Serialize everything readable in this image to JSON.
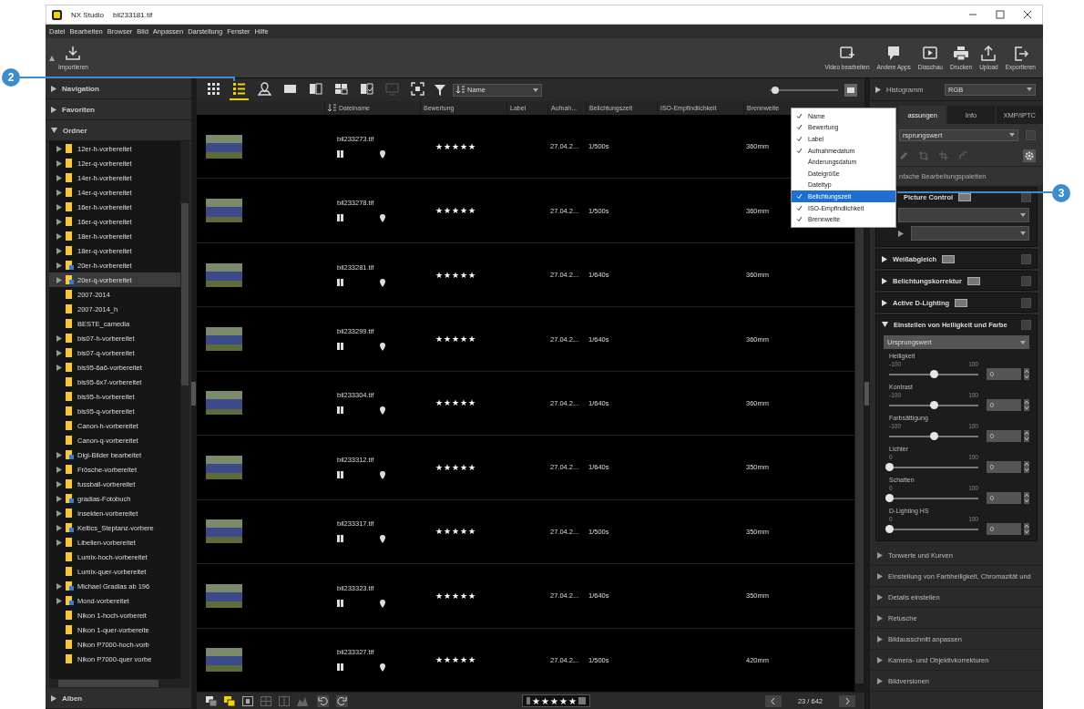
{
  "window": {
    "app_name": "NX Studio",
    "title": "bil233181.tif"
  },
  "menu": [
    "Datei",
    "Bearbeiten",
    "Browser",
    "Bild",
    "Anpassen",
    "Darstellung",
    "Fenster",
    "Hilfe"
  ],
  "toolbar": {
    "left": [
      {
        "kind": "import",
        "label": "Importieren"
      }
    ],
    "right": [
      {
        "kind": "video",
        "label": "Video bearbeiten"
      },
      {
        "kind": "apps",
        "label": "Andere Apps"
      },
      {
        "kind": "slideshow",
        "label": "Diaschau"
      },
      {
        "kind": "print",
        "label": "Drucken"
      },
      {
        "kind": "upload",
        "label": "Upload"
      },
      {
        "kind": "export",
        "label": "Exportieren"
      }
    ]
  },
  "sidebar": {
    "sections": [
      {
        "label": "Navigation",
        "expanded": false
      },
      {
        "label": "Favoriten",
        "expanded": false
      },
      {
        "label": "Ordner",
        "expanded": true
      }
    ],
    "folders": [
      {
        "label": "12er-h-vorbereitet",
        "expandable": true,
        "shared": false,
        "selected": false
      },
      {
        "label": "12er-q-vorbereitet",
        "expandable": true,
        "shared": false,
        "selected": false
      },
      {
        "label": "14er-h-vorbereitet",
        "expandable": true,
        "shared": false,
        "selected": false
      },
      {
        "label": "14er-q-vorbereitet",
        "expandable": true,
        "shared": false,
        "selected": false
      },
      {
        "label": "16er-h-vorbereitet",
        "expandable": true,
        "shared": false,
        "selected": false
      },
      {
        "label": "16er-q-vorbereitet",
        "expandable": true,
        "shared": false,
        "selected": false
      },
      {
        "label": "18er-h-vorbereitet",
        "expandable": true,
        "shared": false,
        "selected": false
      },
      {
        "label": "18er-q-vorbereitet",
        "expandable": true,
        "shared": false,
        "selected": false
      },
      {
        "label": "20er-h-vorbereitet",
        "expandable": true,
        "shared": true,
        "selected": false
      },
      {
        "label": "20er-q-vorbereitet",
        "expandable": true,
        "shared": true,
        "selected": true
      },
      {
        "label": "2007-2014",
        "expandable": false,
        "shared": false,
        "selected": false
      },
      {
        "label": "2007-2014_h",
        "expandable": false,
        "shared": false,
        "selected": false
      },
      {
        "label": "BESTE_camedia",
        "expandable": false,
        "shared": false,
        "selected": false
      },
      {
        "label": "bis07-h-vorbereitet",
        "expandable": true,
        "shared": false,
        "selected": false
      },
      {
        "label": "bis07-q-vorbereitet",
        "expandable": true,
        "shared": false,
        "selected": false
      },
      {
        "label": "bis95-6a6-vorbereitet",
        "expandable": true,
        "shared": false,
        "selected": false
      },
      {
        "label": "bis95-6x7-vorbereitet",
        "expandable": false,
        "shared": false,
        "selected": false
      },
      {
        "label": "bis95-h-vorbereitet",
        "expandable": false,
        "shared": false,
        "selected": false
      },
      {
        "label": "bis95-q-vorbereitet",
        "expandable": false,
        "shared": false,
        "selected": false
      },
      {
        "label": "Canon-h-vorbereitet",
        "expandable": false,
        "shared": false,
        "selected": false
      },
      {
        "label": "Canon-q-vorbereitet",
        "expandable": false,
        "shared": false,
        "selected": false
      },
      {
        "label": "Digi-Bilder bearbeitet",
        "expandable": true,
        "shared": true,
        "selected": false
      },
      {
        "label": "Frösche-vorbereitet",
        "expandable": true,
        "shared": false,
        "selected": false
      },
      {
        "label": "fussball-vorbereitet",
        "expandable": true,
        "shared": false,
        "selected": false
      },
      {
        "label": "gradias-Fotobuch",
        "expandable": true,
        "shared": true,
        "selected": false
      },
      {
        "label": "Insekten-vorbereitet",
        "expandable": true,
        "shared": false,
        "selected": false
      },
      {
        "label": "Keltics_Steptanz-vorbere",
        "expandable": true,
        "shared": true,
        "selected": false
      },
      {
        "label": "Libellen-vorbereitet",
        "expandable": true,
        "shared": false,
        "selected": false
      },
      {
        "label": "Lumix-hoch-vorbereitet",
        "expandable": false,
        "shared": false,
        "selected": false
      },
      {
        "label": "Lumix-quer-vorbereitet",
        "expandable": false,
        "shared": false,
        "selected": false
      },
      {
        "label": "Michael Gradias ab 196",
        "expandable": true,
        "shared": true,
        "selected": false
      },
      {
        "label": "Mond-vorbereitet",
        "expandable": true,
        "shared": true,
        "selected": false
      },
      {
        "label": "Nikon 1-hoch-vorbereit",
        "expandable": false,
        "shared": false,
        "selected": false
      },
      {
        "label": "Nikon 1-quer-vorbereite",
        "expandable": false,
        "shared": false,
        "selected": false
      },
      {
        "label": "Nikon P7000-hoch-vorb",
        "expandable": false,
        "shared": false,
        "selected": false
      },
      {
        "label": "Nikon P7000-quer vorbe",
        "expandable": false,
        "shared": false,
        "selected": false
      }
    ],
    "footer": {
      "label": "Alben",
      "expanded": false
    }
  },
  "browser": {
    "view_buttons": [
      {
        "kind": "grid",
        "selected": false,
        "disabled": false
      },
      {
        "kind": "list",
        "selected": true,
        "disabled": false
      },
      {
        "kind": "map",
        "selected": false,
        "disabled": false
      },
      {
        "kind": "single",
        "selected": false,
        "disabled": false
      },
      {
        "kind": "split",
        "selected": false,
        "disabled": false
      },
      {
        "kind": "quad",
        "selected": false,
        "disabled": false
      },
      {
        "kind": "compare",
        "selected": false,
        "disabled": false
      },
      {
        "kind": "monitor",
        "selected": false,
        "disabled": true
      },
      {
        "kind": "fit",
        "selected": false,
        "disabled": false
      }
    ],
    "sort": {
      "value": "Name"
    },
    "zoom": {
      "level": 0.08
    },
    "columns": [
      {
        "label": "Dateiname",
        "sorted": true
      },
      {
        "label": "Bewertung",
        "sorted": false
      },
      {
        "label": "Label",
        "sorted": false
      },
      {
        "label": "Aufnah...",
        "sorted": false
      },
      {
        "label": "Belichtungszeit",
        "sorted": false
      },
      {
        "label": "ISO-Empfindlichkeit",
        "sorted": false
      },
      {
        "label": "Brennweite",
        "sorted": false
      }
    ],
    "rows": [
      {
        "file": "bil233273.tif",
        "stars": 5,
        "date": "27.04.2...",
        "exposure": "1/500s",
        "focal": "360mm"
      },
      {
        "file": "bil233278.tif",
        "stars": 5,
        "date": "27.04.2...",
        "exposure": "1/500s",
        "focal": "360mm"
      },
      {
        "file": "bil233281.tif",
        "stars": 5,
        "date": "27.04.2...",
        "exposure": "1/640s",
        "focal": "360mm"
      },
      {
        "file": "bil233299.tif",
        "stars": 5,
        "date": "27.04.2...",
        "exposure": "1/640s",
        "focal": "360mm"
      },
      {
        "file": "bil233304.tif",
        "stars": 5,
        "date": "27.04.2...",
        "exposure": "1/640s",
        "focal": "360mm"
      },
      {
        "file": "bil233312.tif",
        "stars": 5,
        "date": "27.04.2...",
        "exposure": "1/640s",
        "focal": "350mm"
      },
      {
        "file": "bil233317.tif",
        "stars": 5,
        "date": "27.04.2...",
        "exposure": "1/500s",
        "focal": "350mm"
      },
      {
        "file": "bil233323.tif",
        "stars": 5,
        "date": "27.04.2...",
        "exposure": "1/640s",
        "focal": "350mm"
      },
      {
        "file": "bil233327.tif",
        "stars": 5,
        "date": "27.04.2...",
        "exposure": "1/500s",
        "focal": "420mm"
      }
    ],
    "column_menu": [
      {
        "label": "Name",
        "checked": true,
        "selected": false
      },
      {
        "label": "Bewertung",
        "checked": true,
        "selected": false
      },
      {
        "label": "Label",
        "checked": true,
        "selected": false
      },
      {
        "label": "Aufnahmedatum",
        "checked": true,
        "selected": false
      },
      {
        "label": "Änderungsdatum",
        "checked": false,
        "selected": false
      },
      {
        "label": "Dateigröße",
        "checked": false,
        "selected": false
      },
      {
        "label": "Dateityp",
        "checked": false,
        "selected": false
      },
      {
        "label": "Belichtungszeit",
        "checked": true,
        "selected": true
      },
      {
        "label": "ISO-Empfindlichkeit",
        "checked": true,
        "selected": false
      },
      {
        "label": "Brennweite",
        "checked": true,
        "selected": false
      }
    ],
    "rating_filter": {
      "stars": 5
    },
    "pager": "23 / 642"
  },
  "adjust_panel": {
    "histogram": {
      "label": "Histogramm",
      "channel": "RGB"
    },
    "tabs": [
      {
        "label": "assungen",
        "selected": true
      },
      {
        "label": "Info",
        "selected": false
      },
      {
        "label": "XMP/IPTC",
        "selected": false
      }
    ],
    "preset": {
      "value": "rsprungswert",
      "checked": false
    },
    "section_title": "nfache Bearbeitungspaletten",
    "palettes": [
      {
        "label": "Picture Control",
        "badge": true,
        "checked": false
      },
      {
        "label": "Weißabgleich",
        "expanded": false,
        "badge": true,
        "checked": false
      },
      {
        "label": "Belichtungskorrektur",
        "expanded": false,
        "badge": true,
        "checked": false
      },
      {
        "label": "Active D-Lighting",
        "expanded": false,
        "badge": true,
        "checked": false
      },
      {
        "label": "Einstellen von Helligkeit und Farbe",
        "expanded": true,
        "badge": false,
        "checked": false,
        "preset": "Ursprungswert",
        "sliders": [
          {
            "label": "Helligkeit",
            "min": "-100",
            "max": "100",
            "level": 0.5,
            "value": "0"
          },
          {
            "label": "Kontrast",
            "min": "-100",
            "max": "100",
            "level": 0.5,
            "value": "0"
          },
          {
            "label": "Farbsättigung",
            "min": "-100",
            "max": "100",
            "level": 0.5,
            "value": "0"
          },
          {
            "label": "Lichter",
            "min": "0",
            "max": "100",
            "level": 0,
            "value": "0"
          },
          {
            "label": "Schatten",
            "min": "0",
            "max": "100",
            "level": 0,
            "value": "0"
          },
          {
            "label": "D-Lighting HS",
            "min": "0",
            "max": "100",
            "level": 0,
            "value": "0"
          }
        ]
      }
    ],
    "more": [
      {
        "label": "Tonwerte und Kurven"
      },
      {
        "label": "Einstellung von Farbhelligkeit, Chromazität und"
      },
      {
        "label": "Details einstellen"
      },
      {
        "label": "Retusche"
      },
      {
        "label": "Bildausschnitt anpassen"
      },
      {
        "label": "Kamera- und Objektivkorrekturen"
      },
      {
        "label": "Bildversionen"
      }
    ]
  },
  "callouts": [
    {
      "number": "2"
    },
    {
      "number": "3"
    }
  ]
}
